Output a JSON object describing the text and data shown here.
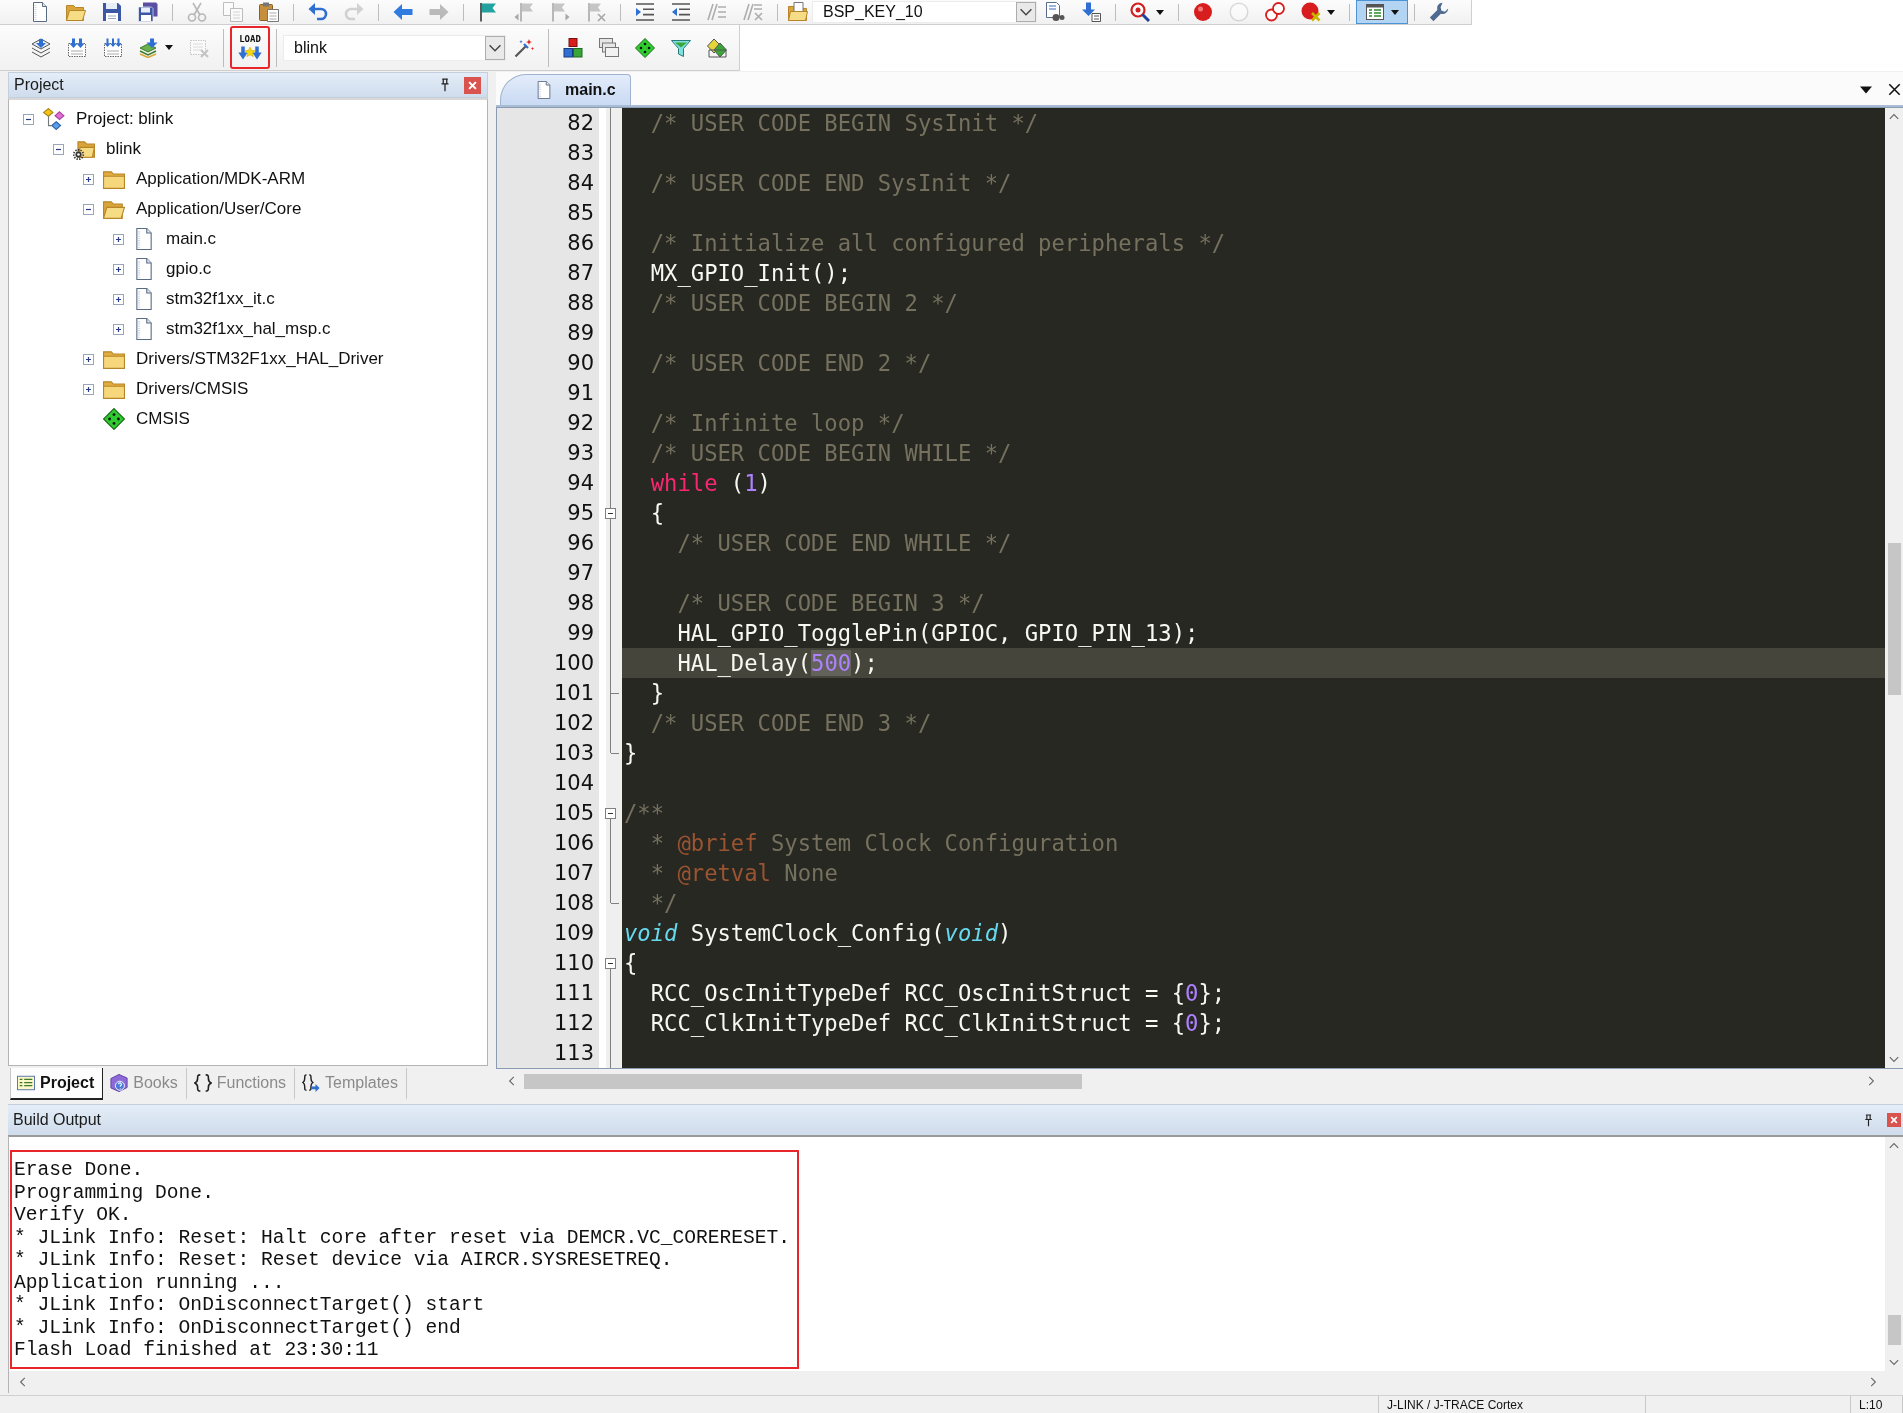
{
  "toolbar_1": {
    "items": [
      {
        "kind": "button",
        "disabled": false,
        "on": false,
        "highlighted": false
      },
      {
        "kind": "button",
        "disabled": false,
        "on": false,
        "highlighted": false
      },
      {
        "kind": "button",
        "disabled": false,
        "on": false,
        "highlighted": false
      },
      {
        "kind": "button",
        "disabled": false,
        "on": false,
        "highlighted": false
      },
      {
        "kind": "separator"
      },
      {
        "kind": "button",
        "disabled": true,
        "on": false,
        "highlighted": false
      },
      {
        "kind": "button",
        "disabled": true,
        "on": false,
        "highlighted": false
      },
      {
        "kind": "button",
        "disabled": false,
        "on": false,
        "highlighted": false
      },
      {
        "kind": "separator"
      },
      {
        "kind": "button",
        "disabled": false,
        "on": false,
        "highlighted": false
      },
      {
        "kind": "button",
        "disabled": true,
        "on": false,
        "highlighted": false
      },
      {
        "kind": "separator"
      },
      {
        "kind": "button",
        "disabled": false,
        "on": false,
        "highlighted": false
      },
      {
        "kind": "button",
        "disabled": true,
        "on": false,
        "highlighted": false
      },
      {
        "kind": "separator"
      },
      {
        "kind": "button",
        "disabled": false,
        "on": false,
        "highlighted": false
      },
      {
        "kind": "button",
        "disabled": true,
        "on": false,
        "highlighted": false
      },
      {
        "kind": "button",
        "disabled": true,
        "on": false,
        "highlighted": false
      },
      {
        "kind": "button",
        "disabled": true,
        "on": false,
        "highlighted": false
      },
      {
        "kind": "separator"
      },
      {
        "kind": "button",
        "disabled": false,
        "on": false,
        "highlighted": false
      },
      {
        "kind": "button",
        "disabled": false,
        "on": false,
        "highlighted": false
      },
      {
        "kind": "button",
        "disabled": true,
        "on": false,
        "highlighted": false
      },
      {
        "kind": "button",
        "disabled": true,
        "on": false,
        "highlighted": false
      },
      {
        "kind": "separator"
      },
      {
        "kind": "button",
        "disabled": false,
        "on": false,
        "highlighted": false
      },
      {
        "kind": "combo",
        "value": "BSP_KEY_10"
      },
      {
        "kind": "button",
        "disabled": false,
        "on": false,
        "highlighted": false
      },
      {
        "kind": "button",
        "disabled": false,
        "on": false,
        "highlighted": false
      },
      {
        "kind": "separator"
      },
      {
        "kind": "dropdown-button",
        "disabled": false,
        "on": false,
        "highlighted": false
      },
      {
        "kind": "separator"
      },
      {
        "kind": "button",
        "disabled": false,
        "on": false,
        "highlighted": false
      },
      {
        "kind": "button",
        "disabled": true,
        "on": false,
        "highlighted": false
      },
      {
        "kind": "button",
        "disabled": false,
        "on": false,
        "highlighted": false
      },
      {
        "kind": "dropdown-button",
        "disabled": false,
        "on": false,
        "highlighted": false
      },
      {
        "kind": "separator"
      },
      {
        "kind": "dropdown-button",
        "disabled": false,
        "on": true,
        "highlighted": false
      },
      {
        "kind": "separator"
      },
      {
        "kind": "button",
        "disabled": false,
        "on": false,
        "highlighted": false
      }
    ]
  },
  "toolbar_2": {
    "items": [
      {
        "kind": "button",
        "disabled": false,
        "on": false,
        "highlighted": false
      },
      {
        "kind": "button",
        "disabled": false,
        "on": false,
        "highlighted": false
      },
      {
        "kind": "button",
        "disabled": false,
        "on": false,
        "highlighted": false
      },
      {
        "kind": "dropdown-button",
        "disabled": false,
        "on": false,
        "highlighted": false
      },
      {
        "kind": "button",
        "disabled": true,
        "on": false,
        "highlighted": false
      },
      {
        "kind": "separator"
      },
      {
        "kind": "button",
        "label": "LOAD",
        "disabled": false,
        "on": false,
        "highlighted": true
      },
      {
        "kind": "separator"
      },
      {
        "kind": "combo",
        "value": "blink"
      },
      {
        "kind": "button",
        "disabled": false,
        "on": false,
        "highlighted": false
      },
      {
        "kind": "separator"
      },
      {
        "kind": "button",
        "disabled": false,
        "on": false,
        "highlighted": false
      },
      {
        "kind": "button",
        "disabled": false,
        "on": false,
        "highlighted": false
      },
      {
        "kind": "button",
        "disabled": false,
        "on": false,
        "highlighted": false
      },
      {
        "kind": "button",
        "disabled": false,
        "on": false,
        "highlighted": false
      },
      {
        "kind": "button",
        "disabled": false,
        "on": false,
        "highlighted": false
      }
    ]
  },
  "project_panel": {
    "title": "Project",
    "tree": [
      {
        "label": "Project: blink",
        "kind": "project",
        "expanded": true,
        "children": [
          {
            "label": "blink",
            "kind": "target",
            "expanded": true,
            "children": [
              {
                "label": "Application/MDK-ARM",
                "kind": "folder",
                "expanded": false
              },
              {
                "label": "Application/User/Core",
                "kind": "folder",
                "expanded": true,
                "children": [
                  {
                    "label": "main.c",
                    "kind": "file",
                    "expanded": false
                  },
                  {
                    "label": "gpio.c",
                    "kind": "file",
                    "expanded": false
                  },
                  {
                    "label": "stm32f1xx_it.c",
                    "kind": "file",
                    "expanded": false
                  },
                  {
                    "label": "stm32f1xx_hal_msp.c",
                    "kind": "file",
                    "expanded": false
                  }
                ]
              },
              {
                "label": "Drivers/STM32F1xx_HAL_Driver",
                "kind": "folder",
                "expanded": false
              },
              {
                "label": "Drivers/CMSIS",
                "kind": "folder",
                "expanded": false
              },
              {
                "label": "CMSIS",
                "kind": "component"
              }
            ]
          }
        ]
      }
    ],
    "tabs": [
      {
        "label": "Project",
        "kind": "project",
        "selected": true
      },
      {
        "label": "Books",
        "kind": "books",
        "selected": false
      },
      {
        "label": "Functions",
        "kind": "functions",
        "selected": false
      },
      {
        "label": "Templates",
        "kind": "templates",
        "selected": false
      }
    ]
  },
  "editor": {
    "tabs": [
      {
        "label": "main.c",
        "selected": true
      }
    ],
    "lines": [
      {
        "number": "82",
        "current": false,
        "kind": "fold-body",
        "tokens": [
          {
            "kind": "comment",
            "text": "  /* USER CODE BEGIN SysInit */"
          }
        ]
      },
      {
        "number": "83",
        "current": false,
        "kind": "fold-body"
      },
      {
        "number": "84",
        "current": false,
        "kind": "fold-body",
        "tokens": [
          {
            "kind": "comment",
            "text": "  /* USER CODE END SysInit */"
          }
        ]
      },
      {
        "number": "85",
        "current": false,
        "kind": "fold-body"
      },
      {
        "number": "86",
        "current": false,
        "kind": "fold-body",
        "tokens": [
          {
            "kind": "comment",
            "text": "  /* Initialize all configured peripherals */"
          }
        ]
      },
      {
        "number": "87",
        "current": false,
        "kind": "fold-body",
        "tokens": [
          {
            "kind": "plain",
            "text": "  MX_GPIO_Init();"
          }
        ]
      },
      {
        "number": "88",
        "current": false,
        "kind": "fold-body",
        "tokens": [
          {
            "kind": "comment",
            "text": "  /* USER CODE BEGIN 2 */"
          }
        ]
      },
      {
        "number": "89",
        "current": false,
        "kind": "fold-body"
      },
      {
        "number": "90",
        "current": false,
        "kind": "fold-body",
        "tokens": [
          {
            "kind": "comment",
            "text": "  /* USER CODE END 2 */"
          }
        ]
      },
      {
        "number": "91",
        "current": false,
        "kind": "fold-body"
      },
      {
        "number": "92",
        "current": false,
        "kind": "fold-body",
        "tokens": [
          {
            "kind": "comment",
            "text": "  /* Infinite loop */"
          }
        ]
      },
      {
        "number": "93",
        "current": false,
        "kind": "fold-body",
        "tokens": [
          {
            "kind": "comment",
            "text": "  /* USER CODE BEGIN WHILE */"
          }
        ]
      },
      {
        "number": "94",
        "current": false,
        "kind": "fold-body",
        "tokens": [
          {
            "kind": "keyword",
            "text": "  while"
          },
          {
            "kind": "plain",
            "text": " ("
          },
          {
            "kind": "number",
            "text": "1"
          },
          {
            "kind": "plain",
            "text": ")"
          }
        ]
      },
      {
        "number": "95",
        "current": false,
        "kind": "fold-start",
        "tokens": [
          {
            "kind": "plain",
            "text": "  {"
          }
        ]
      },
      {
        "number": "96",
        "current": false,
        "kind": "fold-body",
        "tokens": [
          {
            "kind": "comment",
            "text": "    /* USER CODE END WHILE */"
          }
        ]
      },
      {
        "number": "97",
        "current": false,
        "kind": "fold-body"
      },
      {
        "number": "98",
        "current": false,
        "kind": "fold-body",
        "tokens": [
          {
            "kind": "comment",
            "text": "    /* USER CODE BEGIN 3 */"
          }
        ]
      },
      {
        "number": "99",
        "current": false,
        "kind": "fold-body",
        "tokens": [
          {
            "kind": "plain",
            "text": "    HAL_GPIO_TogglePin(GPIOC, GPIO_PIN_13);"
          }
        ]
      },
      {
        "number": "100",
        "current": true,
        "kind": "fold-body",
        "tokens": [
          {
            "kind": "plain",
            "text": "    HAL_Delay(",
            "highlighted": false
          },
          {
            "kind": "number",
            "text": "500",
            "highlighted": true
          },
          {
            "kind": "plain",
            "text": ");",
            "highlighted": false
          }
        ]
      },
      {
        "number": "101",
        "current": false,
        "kind": "fold-end",
        "tokens": [
          {
            "kind": "plain",
            "text": "  }"
          }
        ]
      },
      {
        "number": "102",
        "current": false,
        "kind": "fold-body",
        "tokens": [
          {
            "kind": "comment",
            "text": "  /* USER CODE END 3 */"
          }
        ]
      },
      {
        "number": "103",
        "current": false,
        "kind": "fold-end",
        "tokens": [
          {
            "kind": "plain",
            "text": "}"
          }
        ]
      },
      {
        "number": "104",
        "current": false,
        "kind": "plain"
      },
      {
        "number": "105",
        "current": false,
        "kind": "fold-start",
        "tokens": [
          {
            "kind": "comment",
            "text": "/**"
          }
        ]
      },
      {
        "number": "106",
        "current": false,
        "kind": "fold-body",
        "tokens": [
          {
            "kind": "comment",
            "text": "  * "
          },
          {
            "kind": "doctag",
            "text": "@brief"
          },
          {
            "kind": "comment",
            "text": " System Clock Configuration"
          }
        ]
      },
      {
        "number": "107",
        "current": false,
        "kind": "fold-body",
        "tokens": [
          {
            "kind": "comment",
            "text": "  * "
          },
          {
            "kind": "doctag",
            "text": "@retval"
          },
          {
            "kind": "comment",
            "text": " None"
          }
        ]
      },
      {
        "number": "108",
        "current": false,
        "kind": "fold-end",
        "tokens": [
          {
            "kind": "comment",
            "text": "  */"
          }
        ]
      },
      {
        "number": "109",
        "current": false,
        "kind": "plain",
        "tokens": [
          {
            "kind": "type",
            "text": "void"
          },
          {
            "kind": "plain",
            "text": " SystemClock_Config("
          },
          {
            "kind": "type",
            "text": "void"
          },
          {
            "kind": "plain",
            "text": ")"
          }
        ]
      },
      {
        "number": "110",
        "current": false,
        "kind": "fold-start",
        "tokens": [
          {
            "kind": "plain",
            "text": "{"
          }
        ]
      },
      {
        "number": "111",
        "current": false,
        "kind": "fold-body",
        "tokens": [
          {
            "kind": "plain",
            "text": "  RCC_OscInitTypeDef RCC_OscInitStruct = {"
          },
          {
            "kind": "number",
            "text": "0"
          },
          {
            "kind": "plain",
            "text": "};"
          }
        ]
      },
      {
        "number": "112",
        "current": false,
        "kind": "fold-body",
        "tokens": [
          {
            "kind": "plain",
            "text": "  RCC_ClkInitTypeDef RCC_ClkInitStruct = {"
          },
          {
            "kind": "number",
            "text": "0"
          },
          {
            "kind": "plain",
            "text": "};"
          }
        ]
      },
      {
        "number": "113",
        "current": false,
        "kind": "fold-body"
      }
    ]
  },
  "build_output": {
    "title": "Build Output",
    "highlighted": true,
    "lines": [
      "Erase Done.",
      "Programming Done.",
      "Verify OK.",
      "* JLink Info: Reset: Halt core after reset via DEMCR.VC_CORERESET.",
      "* JLink Info: Reset: Reset device via AIRCR.SYSRESETREQ.",
      "Application running ...",
      "* JLink Info: OnDisconnectTarget() start",
      "* JLink Info: OnDisconnectTarget() end",
      "Flash Load finished at 23:30:11"
    ]
  },
  "status_bar": {
    "items": [
      "J-LINK / J-TRACE Cortex",
      "L:10"
    ]
  }
}
